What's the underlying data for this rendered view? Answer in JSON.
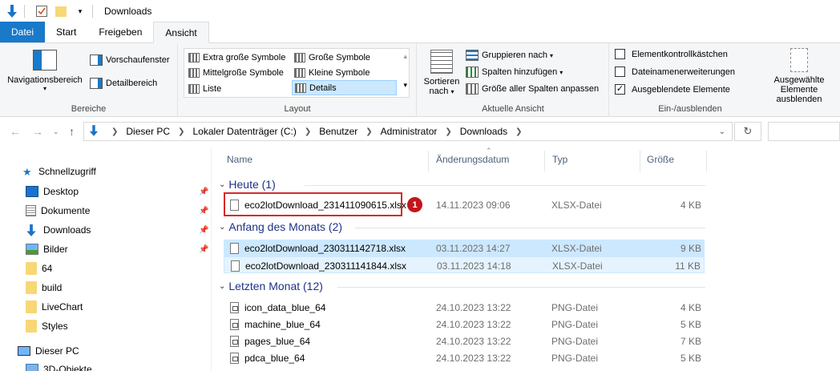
{
  "window": {
    "title": "Downloads"
  },
  "ribbon": {
    "tabs": [
      {
        "label": "Datei"
      },
      {
        "label": "Start"
      },
      {
        "label": "Freigeben"
      },
      {
        "label": "Ansicht"
      }
    ],
    "groups": {
      "bereiche": {
        "label": "Bereiche",
        "nav_pane": "Navigationsbereich",
        "preview_pane": "Vorschaufenster",
        "details_pane": "Detailbereich"
      },
      "layout": {
        "label": "Layout",
        "items": [
          {
            "label": "Extra große Symbole"
          },
          {
            "label": "Große Symbole"
          },
          {
            "label": "Mittelgroße Symbole"
          },
          {
            "label": "Kleine Symbole"
          },
          {
            "label": "Liste"
          },
          {
            "label": "Details"
          }
        ]
      },
      "current_view": {
        "label": "Aktuelle Ansicht",
        "sort_line1": "Sortieren",
        "sort_line2": "nach",
        "group_by": "Gruppieren nach",
        "add_columns": "Spalten hinzufügen",
        "fit_columns": "Größe aller Spalten anpassen"
      },
      "show_hide": {
        "label": "Ein-/ausblenden",
        "item_checkboxes": "Elementkontrollkästchen",
        "extensions": "Dateinamenerweiterungen",
        "hidden_items": "Ausgeblendete Elemente",
        "hide_selected_line1": "Ausgewählte",
        "hide_selected_line2": "Elemente ausblenden"
      }
    }
  },
  "address": {
    "crumbs": [
      "Dieser PC",
      "Lokaler Datenträger (C:)",
      "Benutzer",
      "Administrator",
      "Downloads"
    ]
  },
  "nav": {
    "quick_access": "Schnellzugriff",
    "items": [
      {
        "label": "Desktop"
      },
      {
        "label": "Dokumente"
      },
      {
        "label": "Downloads"
      },
      {
        "label": "Bilder"
      },
      {
        "label": "64"
      },
      {
        "label": "build"
      },
      {
        "label": "LiveChart"
      },
      {
        "label": "Styles"
      }
    ],
    "this_pc": "Dieser PC",
    "objects_3d": "3D-Objekte"
  },
  "columns": {
    "name": "Name",
    "date": "Änderungsdatum",
    "type": "Typ",
    "size": "Größe"
  },
  "groups": [
    {
      "title": "Heute (1)",
      "files": [
        {
          "name": "eco2lotDownload_231411090615.xlsx",
          "date": "14.11.2023 09:06",
          "type": "XLSX-Datei",
          "size": "4 KB"
        }
      ]
    },
    {
      "title": "Anfang des Monats (2)",
      "files": [
        {
          "name": "eco2lotDownload_230311142718.xlsx",
          "date": "03.11.2023 14:27",
          "type": "XLSX-Datei",
          "size": "9 KB"
        },
        {
          "name": "eco2lotDownload_230311141844.xlsx",
          "date": "03.11.2023 14:18",
          "type": "XLSX-Datei",
          "size": "11 KB"
        }
      ]
    },
    {
      "title": "Letzten Monat (12)",
      "files": [
        {
          "name": "icon_data_blue_64",
          "date": "24.10.2023 13:22",
          "type": "PNG-Datei",
          "size": "4 KB"
        },
        {
          "name": "machine_blue_64",
          "date": "24.10.2023 13:22",
          "type": "PNG-Datei",
          "size": "5 KB"
        },
        {
          "name": "pages_blue_64",
          "date": "24.10.2023 13:22",
          "type": "PNG-Datei",
          "size": "7 KB"
        },
        {
          "name": "pdca_blue_64",
          "date": "24.10.2023 13:22",
          "type": "PNG-Datei",
          "size": "5 KB"
        }
      ]
    }
  ],
  "annotation": {
    "badge": "1"
  },
  "colors": {
    "accent": "#1979ca",
    "selection": "#cce8ff",
    "annotation_red": "#d62a2a"
  }
}
